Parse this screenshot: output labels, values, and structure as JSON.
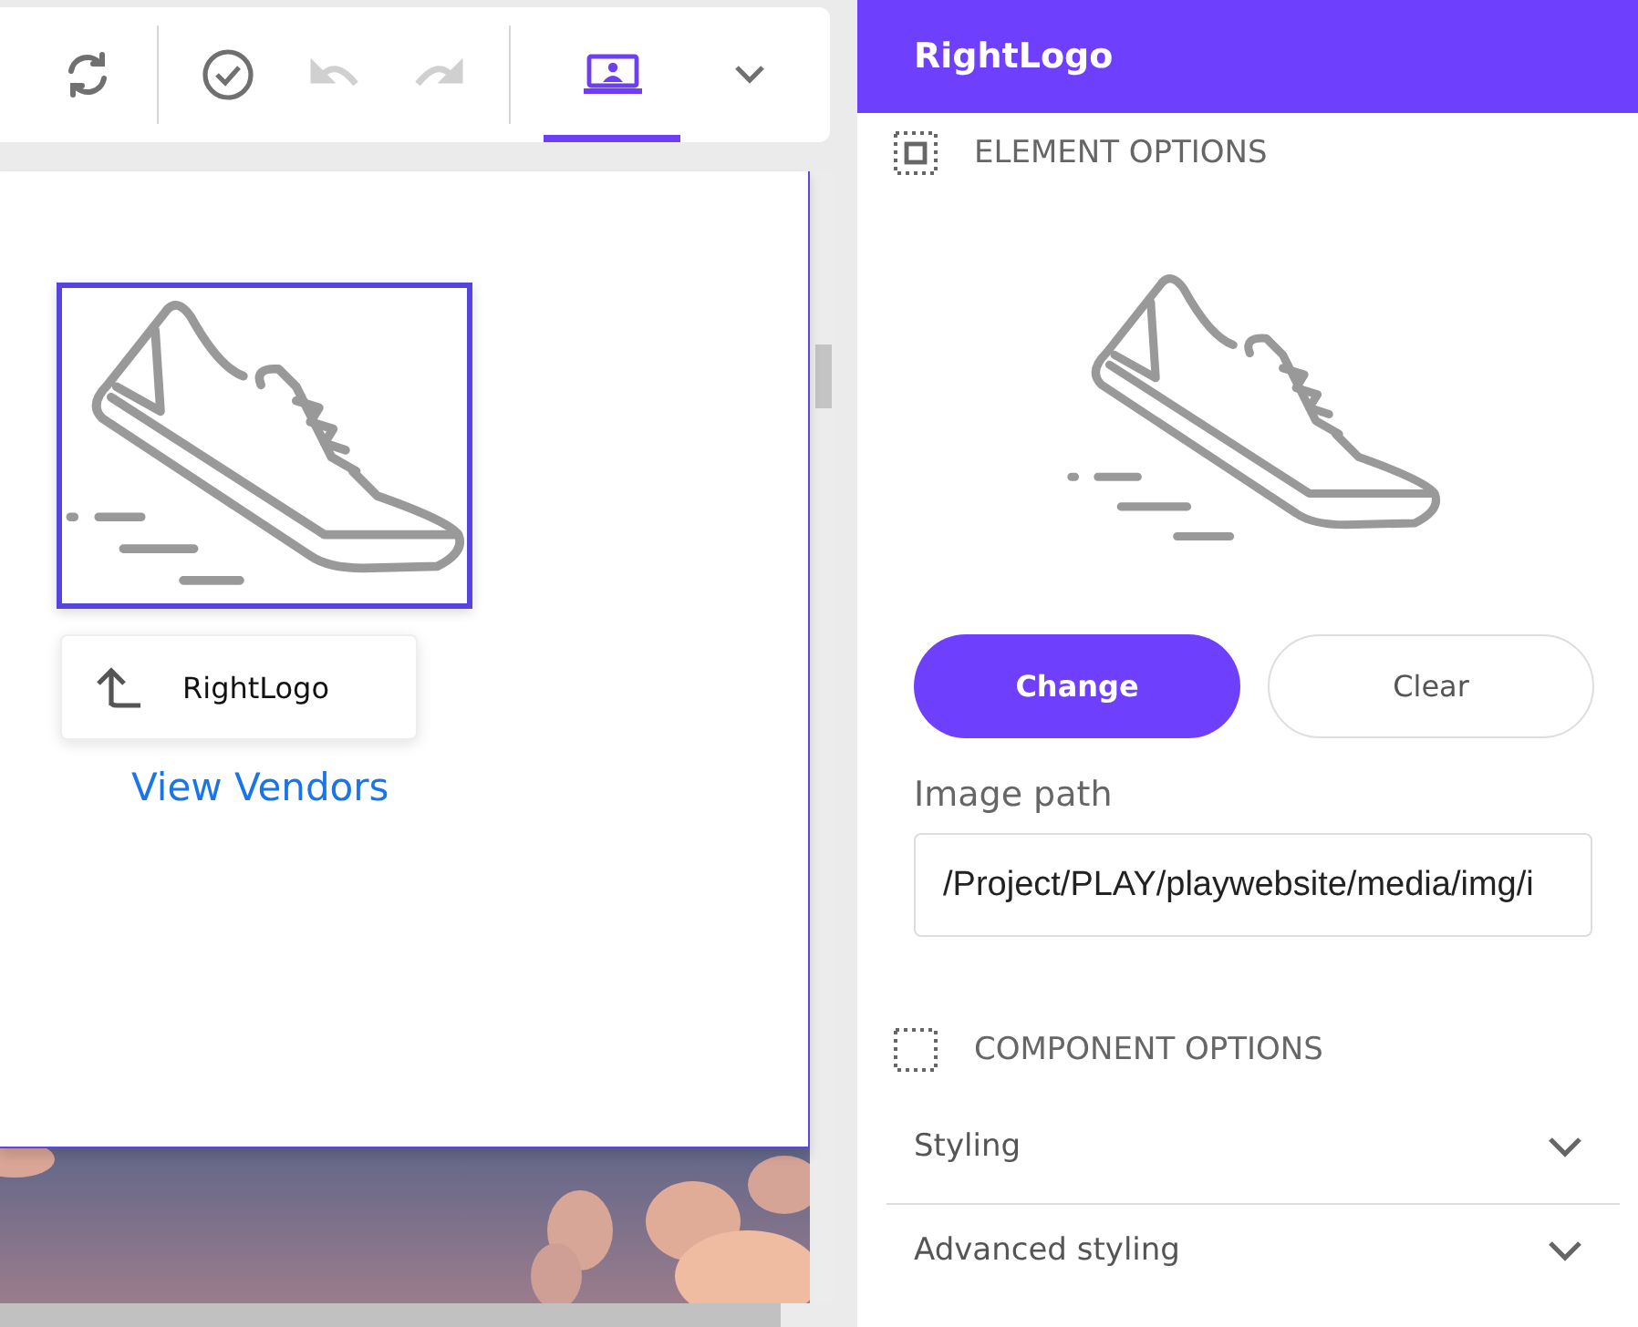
{
  "toolbar": {
    "groups": [
      [
        {
          "kind": "sync",
          "disabled": false
        }
      ],
      [
        {
          "kind": "check",
          "disabled": false
        },
        {
          "kind": "undo",
          "disabled": true
        },
        {
          "kind": "redo",
          "disabled": true
        }
      ],
      [
        {
          "kind": "device",
          "disabled": false,
          "selected": true
        },
        {
          "kind": "more",
          "disabled": false,
          "selected": false
        }
      ]
    ]
  },
  "canvas": {
    "parent_button": {
      "label": "RightLogo"
    },
    "link": "View Vendors"
  },
  "panel": {
    "title": "RightLogo",
    "element_options": {
      "heading": "ELEMENT OPTIONS",
      "buttons": [
        {
          "label": "Change",
          "kind": "primary"
        },
        {
          "label": "Clear",
          "kind": "secondary"
        }
      ],
      "field_label": "Image path",
      "field_value": "/Project/PLAY/playwebsite/media/img/i"
    },
    "component_options": {
      "heading": "COMPONENT OPTIONS",
      "sections": [
        {
          "label": "Styling",
          "expanded": false
        },
        {
          "label": "Advanced styling",
          "expanded": false
        }
      ]
    }
  }
}
